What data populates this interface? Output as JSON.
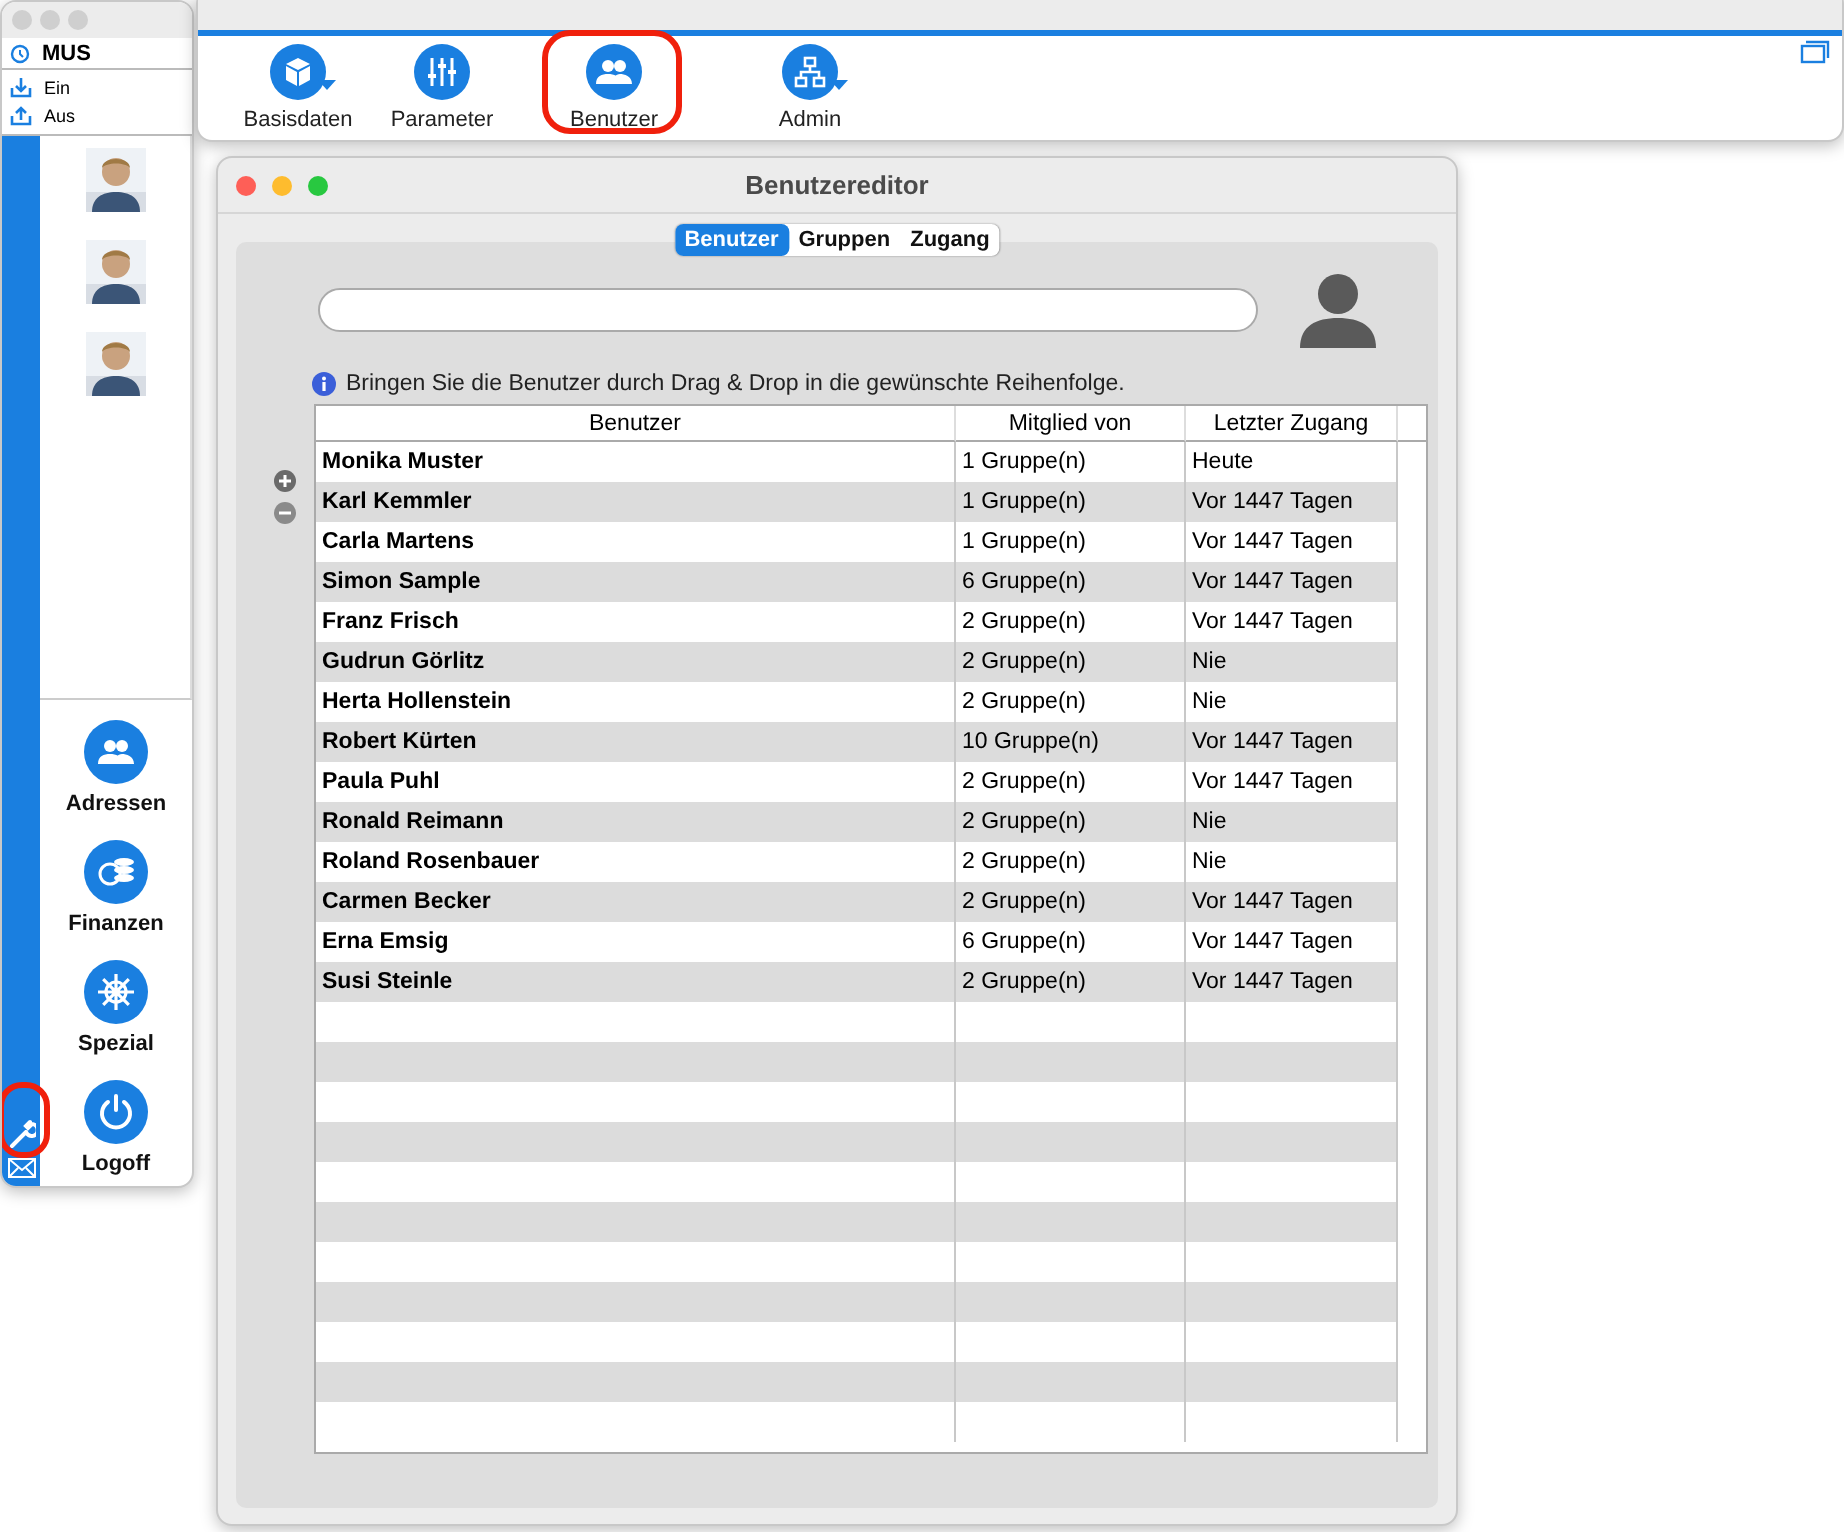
{
  "side_window": {
    "title": "MUS",
    "actions": [
      {
        "label": "Ein",
        "kind": "in"
      },
      {
        "label": "Aus",
        "kind": "out"
      }
    ],
    "modules": [
      {
        "label": "Adressen",
        "kind": "people"
      },
      {
        "label": "Finanzen",
        "kind": "coins"
      },
      {
        "label": "Spezial",
        "kind": "wheel"
      },
      {
        "label": "Logoff",
        "kind": "power"
      }
    ],
    "tools_highlighted": true
  },
  "toolbar": {
    "items": [
      {
        "label": "Basisdaten",
        "kind": "cube",
        "menu": true,
        "highlighted": false
      },
      {
        "label": "Parameter",
        "kind": "sliders",
        "menu": false,
        "highlighted": false
      },
      {
        "label": "Benutzer",
        "kind": "people",
        "menu": false,
        "highlighted": true
      },
      {
        "label": "Admin",
        "kind": "tree",
        "menu": true,
        "highlighted": false
      }
    ]
  },
  "editor": {
    "title": "Benutzereditor",
    "tabs": [
      {
        "label": "Benutzer",
        "selected": true
      },
      {
        "label": "Gruppen",
        "selected": false
      },
      {
        "label": "Zugang",
        "selected": false
      }
    ],
    "hint": "Bringen Sie die Benutzer durch Drag & Drop in die gewünschte Reihenfolge.",
    "table": {
      "columns": [
        "Benutzer",
        "Mitglied von",
        "Letzter Zugang"
      ],
      "rows": [
        [
          "Monika Muster",
          "1 Gruppe(n)",
          "Heute"
        ],
        [
          "Karl Kemmler",
          "1 Gruppe(n)",
          "Vor 1447 Tagen"
        ],
        [
          "Carla Martens",
          "1 Gruppe(n)",
          "Vor 1447 Tagen"
        ],
        [
          "Simon Sample",
          "6 Gruppe(n)",
          "Vor 1447 Tagen"
        ],
        [
          "Franz Frisch",
          "2 Gruppe(n)",
          "Vor 1447 Tagen"
        ],
        [
          "Gudrun Görlitz",
          "2 Gruppe(n)",
          "Nie"
        ],
        [
          "Herta Hollenstein",
          "2 Gruppe(n)",
          "Nie"
        ],
        [
          "Robert Kürten",
          "10 Gruppe(n)",
          "Vor 1447 Tagen"
        ],
        [
          "Paula Puhl",
          "2 Gruppe(n)",
          "Vor 1447 Tagen"
        ],
        [
          "Ronald Reimann",
          "2 Gruppe(n)",
          "Nie"
        ],
        [
          "Roland Rosenbauer",
          "2 Gruppe(n)",
          "Nie"
        ],
        [
          "Carmen Becker",
          "2 Gruppe(n)",
          "Vor 1447 Tagen"
        ],
        [
          "Erna Emsig",
          "6 Gruppe(n)",
          "Vor 1447 Tagen"
        ],
        [
          "Susi Steinle",
          "2 Gruppe(n)",
          "Vor 1447 Tagen"
        ]
      ]
    }
  }
}
